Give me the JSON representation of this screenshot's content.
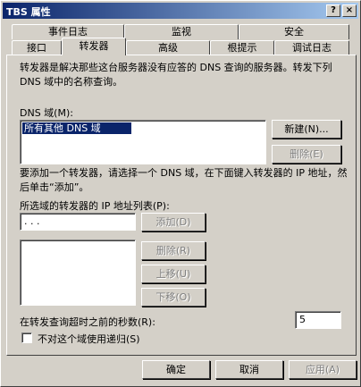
{
  "window": {
    "title": "TBS 属性",
    "help_btn": "?",
    "close_btn": "×"
  },
  "tabs_row1": [
    "事件日志",
    "监视",
    "安全"
  ],
  "tabs_row2": [
    "接口",
    "转发器",
    "高级",
    "根提示",
    "调试日志"
  ],
  "active_tab": "转发器",
  "panel": {
    "description": "转发器是解决那些这台服务器没有应答的 DNS 查询的服务器。转发下列 DNS 域中的名称查询。",
    "dns_domain_label": "DNS 域(M):",
    "dns_domains": [
      "所有其他 DNS 域"
    ],
    "new_button": "新建(N)...",
    "delete_domain_button": "删除(E)",
    "hint": "要添加一个转发器，请选择一个 DNS 域，在下面键入转发器的 IP 地址，然后单击“添加”。",
    "ip_list_label": "所选域的转发器的 IP 地址列表(P):",
    "ip_input_value": ". . .",
    "add_button": "添加(D)",
    "remove_button": "删除(R)",
    "up_button": "上移(U)",
    "down_button": "下移(O)",
    "timeout_label": "在转发查询超时之前的秒数(R):",
    "timeout_value": "5",
    "no_recursion_label": "不对这个域使用递归(S)"
  },
  "footer": {
    "ok": "确定",
    "cancel": "取消",
    "apply": "应用(A)"
  }
}
